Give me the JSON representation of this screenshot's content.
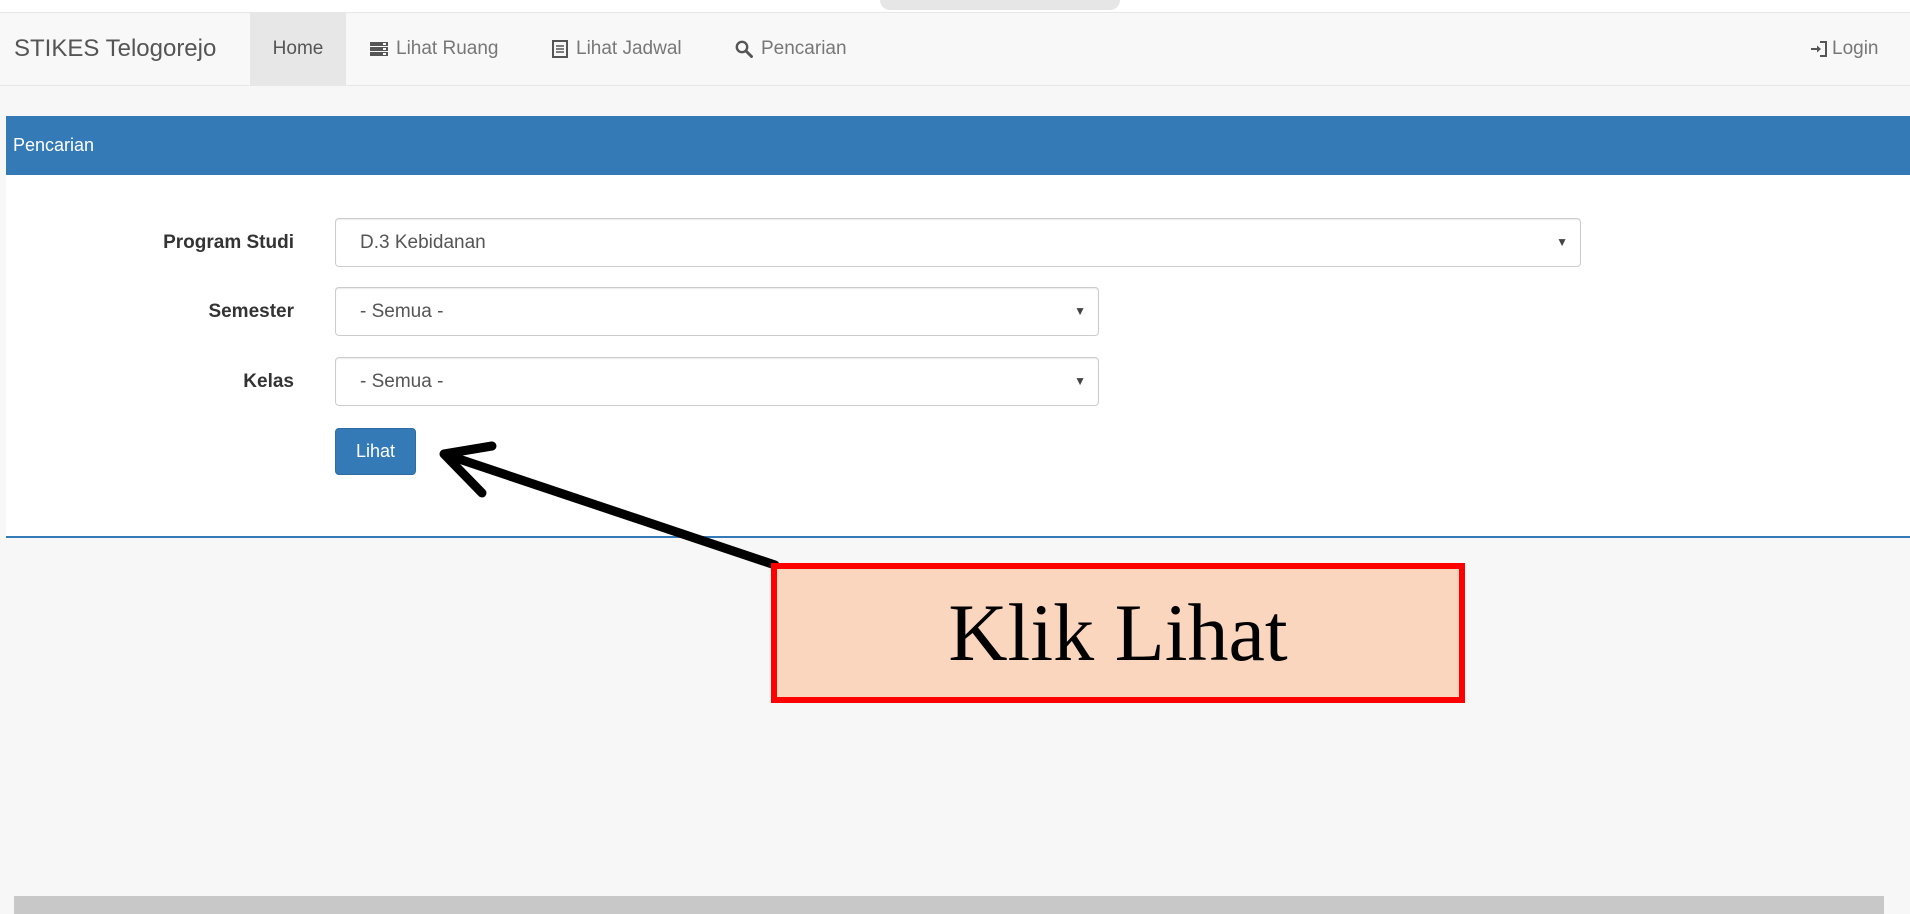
{
  "navbar": {
    "brand": "STIKES Telogorejo",
    "items": [
      {
        "label": "Home",
        "icon": "none"
      },
      {
        "label": "Lihat Ruang",
        "icon": "server-icon"
      },
      {
        "label": "Lihat Jadwal",
        "icon": "list-alt-icon"
      },
      {
        "label": "Pencarian",
        "icon": "search-icon"
      }
    ],
    "login_label": "Login",
    "login_icon": "log-in-icon"
  },
  "panel": {
    "title": "Pencarian"
  },
  "form": {
    "program_studi": {
      "label": "Program Studi",
      "value": "D.3 Kebidanan"
    },
    "semester": {
      "label": "Semester",
      "value": "- Semua -"
    },
    "kelas": {
      "label": "Kelas",
      "value": "- Semua -"
    },
    "submit_label": "Lihat"
  },
  "annotation": {
    "text": "Klik Lihat"
  },
  "colors": {
    "primary": "#337ab7",
    "callout_fill": "#fbd6bf",
    "callout_border": "#ff0000"
  }
}
